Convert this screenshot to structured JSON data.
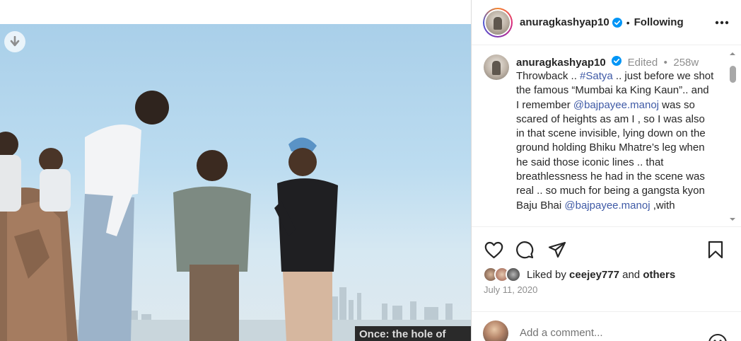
{
  "header": {
    "username": "anuragkashyap10",
    "separator": "•",
    "follow_status": "Following"
  },
  "caption": {
    "username": "anuragkashyap10",
    "edited": "Edited",
    "meta_separator": "•",
    "age": "258w",
    "text_parts": [
      "Throwback .. ",
      "#Satya",
      " .. just before we shot the famous “Mumbai ka King Kaun”.. and I remember ",
      "@bajpayee.manoj",
      " was so scared of heights as am I , so I was also in that scene invisible, lying down on the ground holding Bhiku Mhatre’s leg when he said those iconic lines .. that breathlessness he had in the scene was real .. so much for being a gangsta kyon Baju Bhai ",
      "@bajpayee.manoj",
      " ,with"
    ]
  },
  "likes": {
    "prefix": "Liked by ",
    "user": "ceejey777",
    "middle": " and ",
    "others": "others"
  },
  "date": "July 11, 2020",
  "add_comment": {
    "placeholder": "Add a comment..."
  },
  "media": {
    "caption_strip": "Once: the hole of"
  },
  "colors": {
    "link": "#3f5aa6",
    "verified": "#0095f6",
    "muted": "#8e8e8e"
  },
  "icons": [
    "download-icon",
    "verified-badge-icon",
    "more-options-icon",
    "heart-icon",
    "comment-icon",
    "share-icon",
    "bookmark-icon",
    "emoji-icon"
  ]
}
